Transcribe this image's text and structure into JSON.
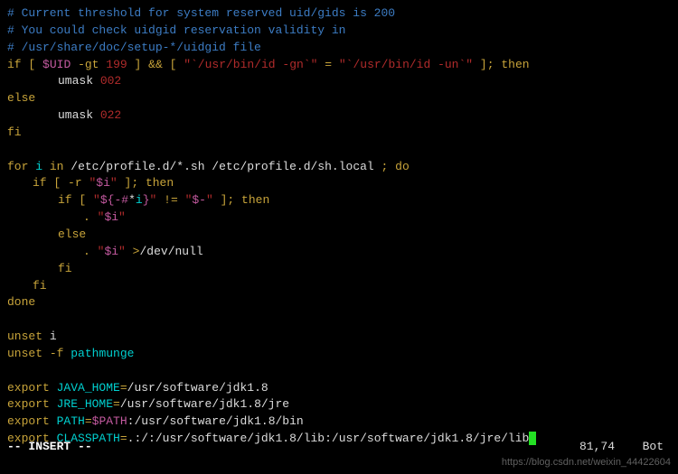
{
  "comments": {
    "c1": "# Current threshold for system reserved uid/gids is 200",
    "c2": "# You could check uidgid reservation validity in",
    "c3": "# /usr/share/doc/setup-*/uidgid file"
  },
  "kw": {
    "if": "if",
    "then": "then",
    "else": "else",
    "fi": "fi",
    "for": "for",
    "in": "in",
    "do": "do",
    "done": "done",
    "unset": "unset",
    "export": "export"
  },
  "sym": {
    "lbrack": "[",
    "rbrack": "]",
    "semi": ";",
    "dand": "&&",
    "eq": "=",
    "neq": "!=",
    "gt": "-gt",
    "r": "-r",
    "dot": ".",
    "f": "-f",
    "redir": ">"
  },
  "ids": {
    "i": "i",
    "pathmunge": "pathmunge"
  },
  "vars": {
    "uid": "$UID",
    "i": "$i",
    "path": "$PATH",
    "dashhash": "${-#",
    "closebrace": "}",
    "dash": "$-"
  },
  "str": {
    "n199": "199",
    "umask": "umask",
    "n002": "002",
    "n022": "022",
    "idgn": "\"`/usr/bin/id -gn`\"",
    "idun": "\"`/usr/bin/id -un`\"",
    "glob": "/etc/profile.d/*.sh /etc/profile.d/sh.local",
    "qiquote": "\"",
    "devnull": "/dev/null",
    "star": "*",
    "iend": "\""
  },
  "exports": {
    "java_home_k": "JAVA_HOME",
    "java_home_v": "/usr/software/jdk1.8",
    "jre_home_k": "JRE_HOME",
    "jre_home_v": "/usr/software/jdk1.8/jre",
    "path_k": "PATH",
    "path_v": ":/usr/software/jdk1.8/bin",
    "classpath_k": "CLASSPATH",
    "classpath_v": ".:/:/usr/software/jdk1.8/lib:/usr/software/jdk1.8/jre/lib"
  },
  "status": {
    "mode": "-- INSERT --",
    "pos": "81,74",
    "scroll": "Bot"
  },
  "watermark": "https://blog.csdn.net/weixin_44422604"
}
